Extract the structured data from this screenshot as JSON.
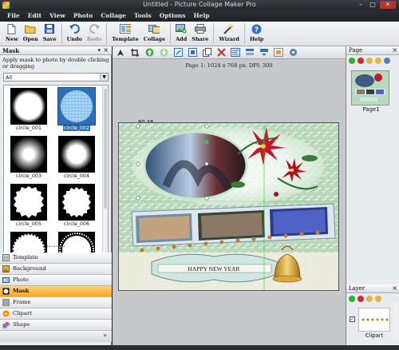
{
  "window": {
    "title": "Untitled - Picture Collage Maker Pro"
  },
  "menu": [
    "File",
    "Edit",
    "View",
    "Photo",
    "Collage",
    "Tools",
    "Options",
    "Help"
  ],
  "toolbar": {
    "new": "New",
    "open": "Open",
    "save": "Save",
    "undo": "Undo",
    "redo": "Redo",
    "template": "Template",
    "collage": "Collage",
    "add": "Add",
    "share": "Share",
    "wizard": "Wizard",
    "help": "Help"
  },
  "mask_panel": {
    "title": "Mask",
    "description": "Apply mask to photo by double clicking or dragging",
    "filter_value": "All",
    "items": [
      {
        "label": "circle_001"
      },
      {
        "label": "circle_002",
        "selected": true
      },
      {
        "label": "circle_003"
      },
      {
        "label": "circle_004"
      },
      {
        "label": "circle_005"
      },
      {
        "label": "circle_006"
      }
    ]
  },
  "categories": [
    {
      "label": "Template",
      "icon": "template-icon"
    },
    {
      "label": "Background",
      "icon": "background-icon"
    },
    {
      "label": "Photo",
      "icon": "photo-icon"
    },
    {
      "label": "Mask",
      "icon": "mask-icon",
      "active": true
    },
    {
      "label": "Frame",
      "icon": "frame-icon"
    },
    {
      "label": "Clipart",
      "icon": "clipart-icon"
    },
    {
      "label": "Shape",
      "icon": "shape-icon"
    }
  ],
  "canvas": {
    "page_info": "Page 1: 1024 x 768 px, DPI: 300",
    "coords": "80,46",
    "banner_text": "HAPPY NEW YEAR"
  },
  "page_panel": {
    "title": "Page",
    "page_label": "Page1"
  },
  "layer_panel": {
    "title": "Layer",
    "item_label": "Clipart",
    "checked": "✓"
  },
  "colors": {
    "active_category": "#f6a623",
    "selection": "#2d6fb7",
    "menu_bg": "#23272c"
  }
}
